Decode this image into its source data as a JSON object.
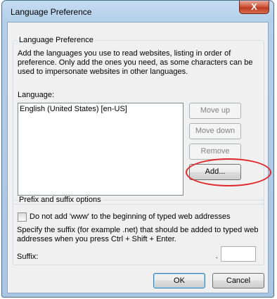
{
  "window": {
    "title": "Language Preference",
    "close_glyph": "X"
  },
  "language_group": {
    "legend": "Language Preference",
    "description": "Add the languages you use to read websites, listing in order of preference. Only add the ones you need, as some characters can be used to impersonate websites in other languages.",
    "list_label": "Language:",
    "languages": [
      "English (United States) [en-US]"
    ]
  },
  "side_buttons": {
    "move_up": "Move up",
    "move_down": "Move down",
    "remove": "Remove",
    "add": "Add..."
  },
  "prefix_group": {
    "legend": "Prefix and suffix options",
    "checkbox_label": "Do not add 'www' to the beginning of typed web addresses",
    "checkbox_checked": false,
    "suffix_description": "Specify the suffix (for example .net) that should be added to typed web addresses when you press Ctrl + Shift + Enter.",
    "suffix_label": "Suffix:",
    "suffix_dot": ".",
    "suffix_value": ""
  },
  "footer": {
    "ok": "OK",
    "cancel": "Cancel"
  },
  "colors": {
    "annotation_circle": "#e0262a",
    "title_bar": "#b4cfe9",
    "close_button": "#c94a30"
  }
}
